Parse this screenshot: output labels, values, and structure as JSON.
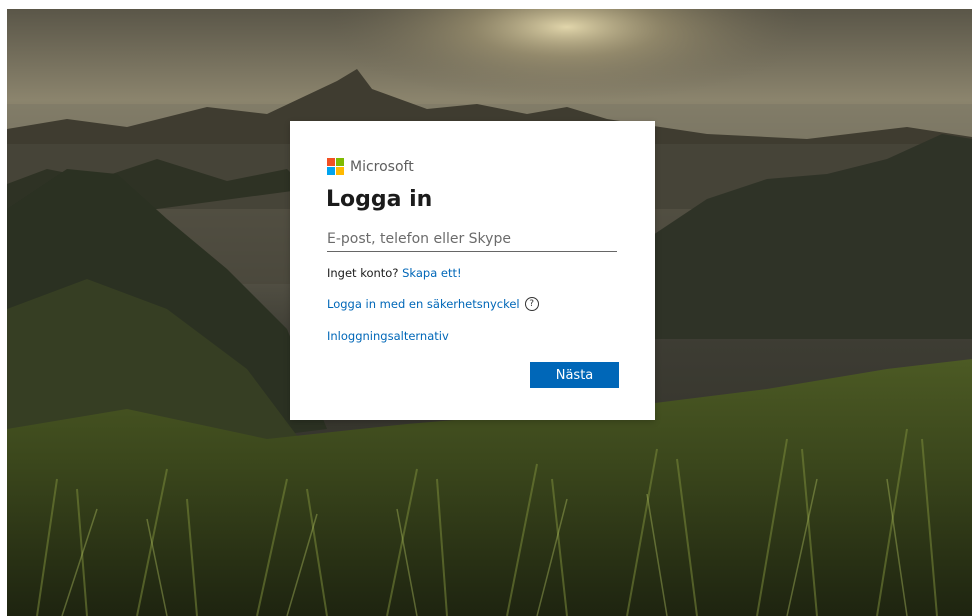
{
  "brand": {
    "name": "Microsoft",
    "logo_colors": [
      "#f25022",
      "#7fba00",
      "#00a4ef",
      "#ffb900"
    ]
  },
  "signin": {
    "title": "Logga in",
    "email_placeholder": "E-post, telefon eller Skype",
    "no_account_text": "Inget konto?",
    "create_link": "Skapa ett!",
    "security_key_link": "Logga in med en säkerhetsnyckel",
    "options_link": "Inloggningsalternativ",
    "next_button": "Nästa"
  },
  "icons": {
    "help": "help-circle-icon"
  },
  "colors": {
    "accent": "#0067b8",
    "card_bg": "#ffffff"
  }
}
